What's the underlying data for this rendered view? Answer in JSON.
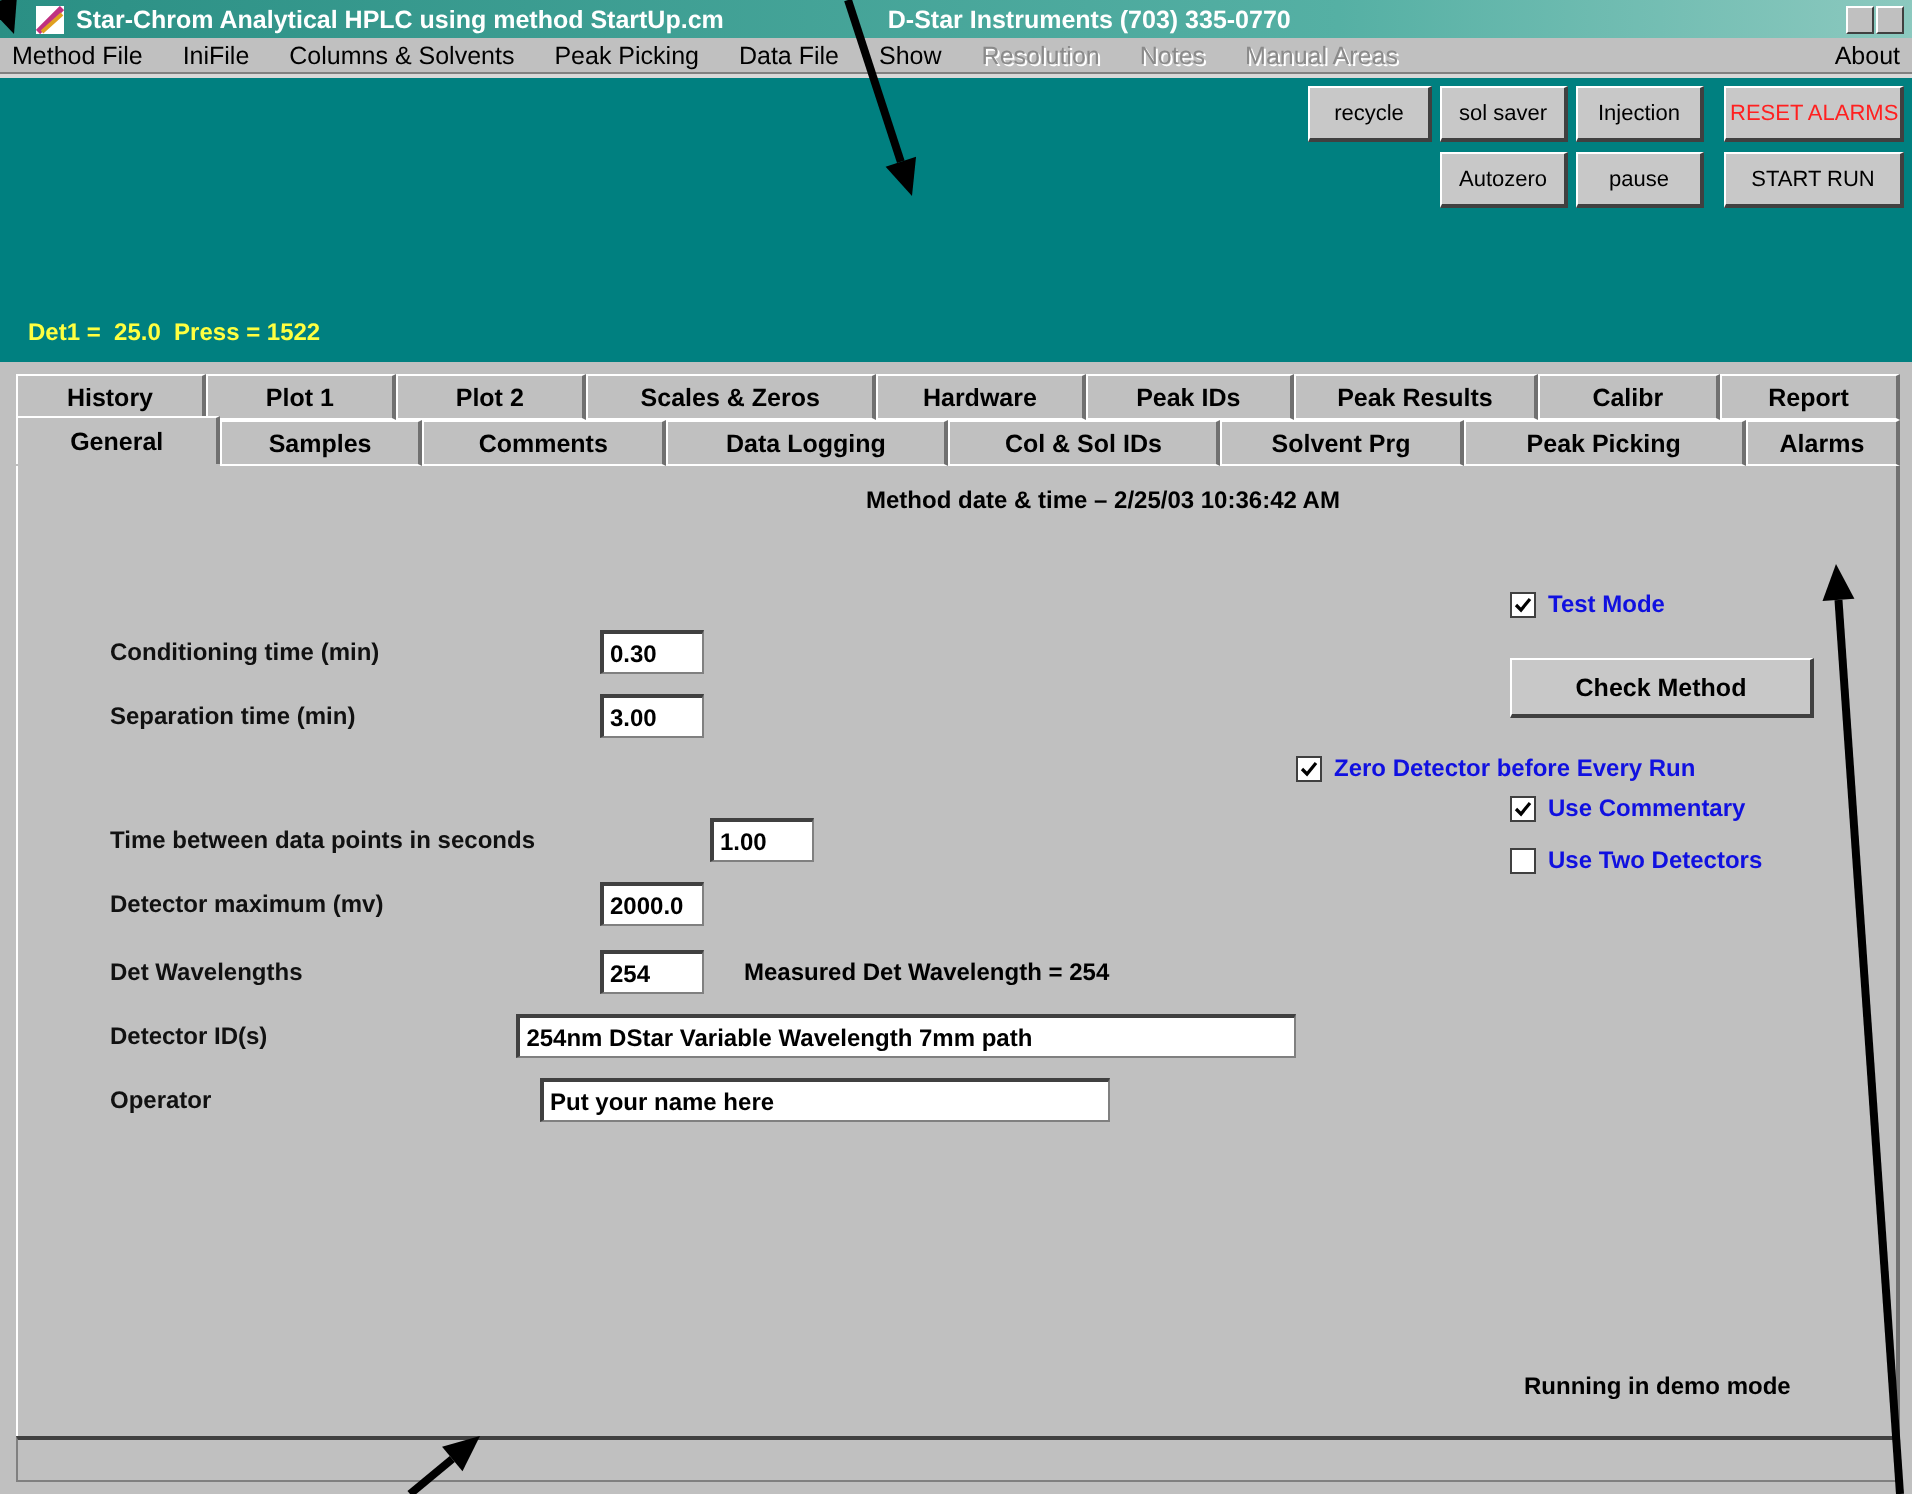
{
  "window": {
    "title": "Star-Chrom Analytical HPLC using method StartUp.cm",
    "subtitle": "D-Star Instruments (703) 335-0770"
  },
  "menu": [
    {
      "label": "Method File",
      "disabled": false
    },
    {
      "label": "IniFile",
      "disabled": false
    },
    {
      "label": "Columns & Solvents",
      "disabled": false
    },
    {
      "label": "Peak Picking",
      "disabled": false
    },
    {
      "label": "Data File",
      "disabled": false
    },
    {
      "label": "Show",
      "disabled": false
    },
    {
      "label": "Resolution",
      "disabled": true
    },
    {
      "label": "Notes",
      "disabled": true
    },
    {
      "label": "Manual Areas",
      "disabled": true
    },
    {
      "label": "About",
      "disabled": false
    }
  ],
  "toolbar": {
    "buttons": [
      {
        "label": "recycle",
        "kind": "normal"
      },
      {
        "label": "sol saver",
        "kind": "normal"
      },
      {
        "label": "Injection",
        "kind": "normal"
      },
      {
        "label": "RESET ALARMS",
        "kind": "alarm"
      },
      {
        "label": "Autozero",
        "kind": "normal"
      },
      {
        "label": "pause",
        "kind": "normal"
      },
      {
        "label": "START RUN",
        "kind": "normal"
      }
    ],
    "readout": "Det1 =  25.0  Press = 1522"
  },
  "tabs": {
    "back_row": [
      {
        "label": "History",
        "selected": false
      },
      {
        "label": "Plot 1",
        "selected": false
      },
      {
        "label": "Plot 2",
        "selected": false
      },
      {
        "label": "Scales & Zeros",
        "selected": false
      },
      {
        "label": "Hardware",
        "selected": false
      },
      {
        "label": "Peak IDs",
        "selected": false
      },
      {
        "label": "Peak Results",
        "selected": false
      },
      {
        "label": "Calibr",
        "selected": false
      },
      {
        "label": "Report",
        "selected": false
      }
    ],
    "front_row": [
      {
        "label": "General",
        "selected": true
      },
      {
        "label": "Samples",
        "selected": false
      },
      {
        "label": "Comments",
        "selected": false
      },
      {
        "label": "Data Logging",
        "selected": false
      },
      {
        "label": "Col & Sol IDs",
        "selected": false
      },
      {
        "label": "Solvent Prg",
        "selected": false
      },
      {
        "label": "Peak Picking",
        "selected": false
      },
      {
        "label": "Alarms",
        "selected": false
      }
    ]
  },
  "general": {
    "method_date": "Method date & time – 2/25/03 10:36:42 AM",
    "fields": [
      {
        "label": "Conditioning time (min)",
        "value": "0.30",
        "kind": "number"
      },
      {
        "label": "Separation time (min)",
        "value": "3.00",
        "kind": "number"
      },
      {
        "label": "Time between data points in seconds",
        "value": "1.00",
        "kind": "number"
      },
      {
        "label": "Detector maximum (mv)",
        "value": "2000.0",
        "kind": "number"
      },
      {
        "label": "Det Wavelengths",
        "value": "254",
        "kind": "number",
        "note": "Measured Det Wavelength = 254"
      },
      {
        "label": "Detector ID(s)",
        "value": "254nm DStar Variable Wavelength 7mm path",
        "kind": "text"
      },
      {
        "label": "Operator",
        "value": "Put your name here",
        "kind": "text"
      }
    ],
    "checkboxes": [
      {
        "label": "Test Mode",
        "checked": true
      },
      {
        "label": "Zero Detector before Every Run",
        "checked": true
      },
      {
        "label": "Use Commentary",
        "checked": true
      },
      {
        "label": "Use Two Detectors",
        "checked": false
      }
    ],
    "check_button": "Check Method",
    "status": "Running in demo mode"
  }
}
